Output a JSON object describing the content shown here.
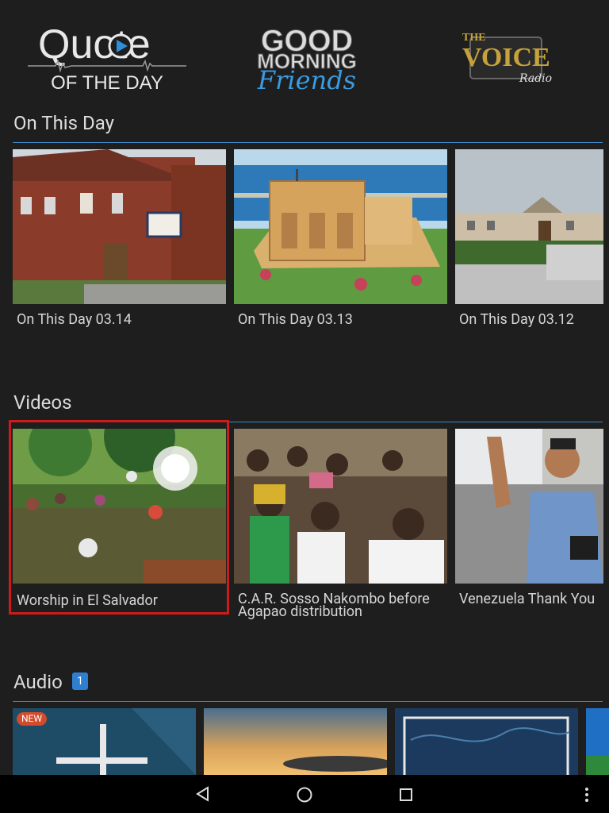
{
  "header": {
    "logos": [
      {
        "name": "quote-of-the-day",
        "line1": "Quote",
        "line2": "OF THE DAY"
      },
      {
        "name": "good-morning-friends",
        "line1": "GOOD",
        "line2": "MORNING",
        "line3": "Friends"
      },
      {
        "name": "the-voice-radio",
        "line1": "THE",
        "line2": "VOICE",
        "line3": "Radio"
      }
    ]
  },
  "sections": {
    "on_this_day": {
      "title": "On This Day",
      "items": [
        {
          "caption": "On This Day 03.14"
        },
        {
          "caption": "On This Day 03.13"
        },
        {
          "caption": "On This Day 03.12"
        }
      ]
    },
    "videos": {
      "title": "Videos",
      "items": [
        {
          "caption": "Worship in El Salvador"
        },
        {
          "caption": "C.A.R. Sosso Nakombo before Agapao distribution"
        },
        {
          "caption": "Venezuela Thank You"
        }
      ]
    },
    "audio": {
      "title": "Audio",
      "badge": "1",
      "items": [
        {
          "badge": "NEW"
        },
        {},
        {},
        {}
      ]
    }
  },
  "navbar": {
    "back": "back-icon",
    "home": "home-icon",
    "recents": "recents-icon",
    "more": "more-icon"
  },
  "colors": {
    "background": "#1e1e1e",
    "accent_rule": "#3c86c6",
    "badge": "#2f7fd1",
    "new_badge": "#d24b2a",
    "focus": "#cc1b1b",
    "voice_gold": "#c6a23a"
  }
}
